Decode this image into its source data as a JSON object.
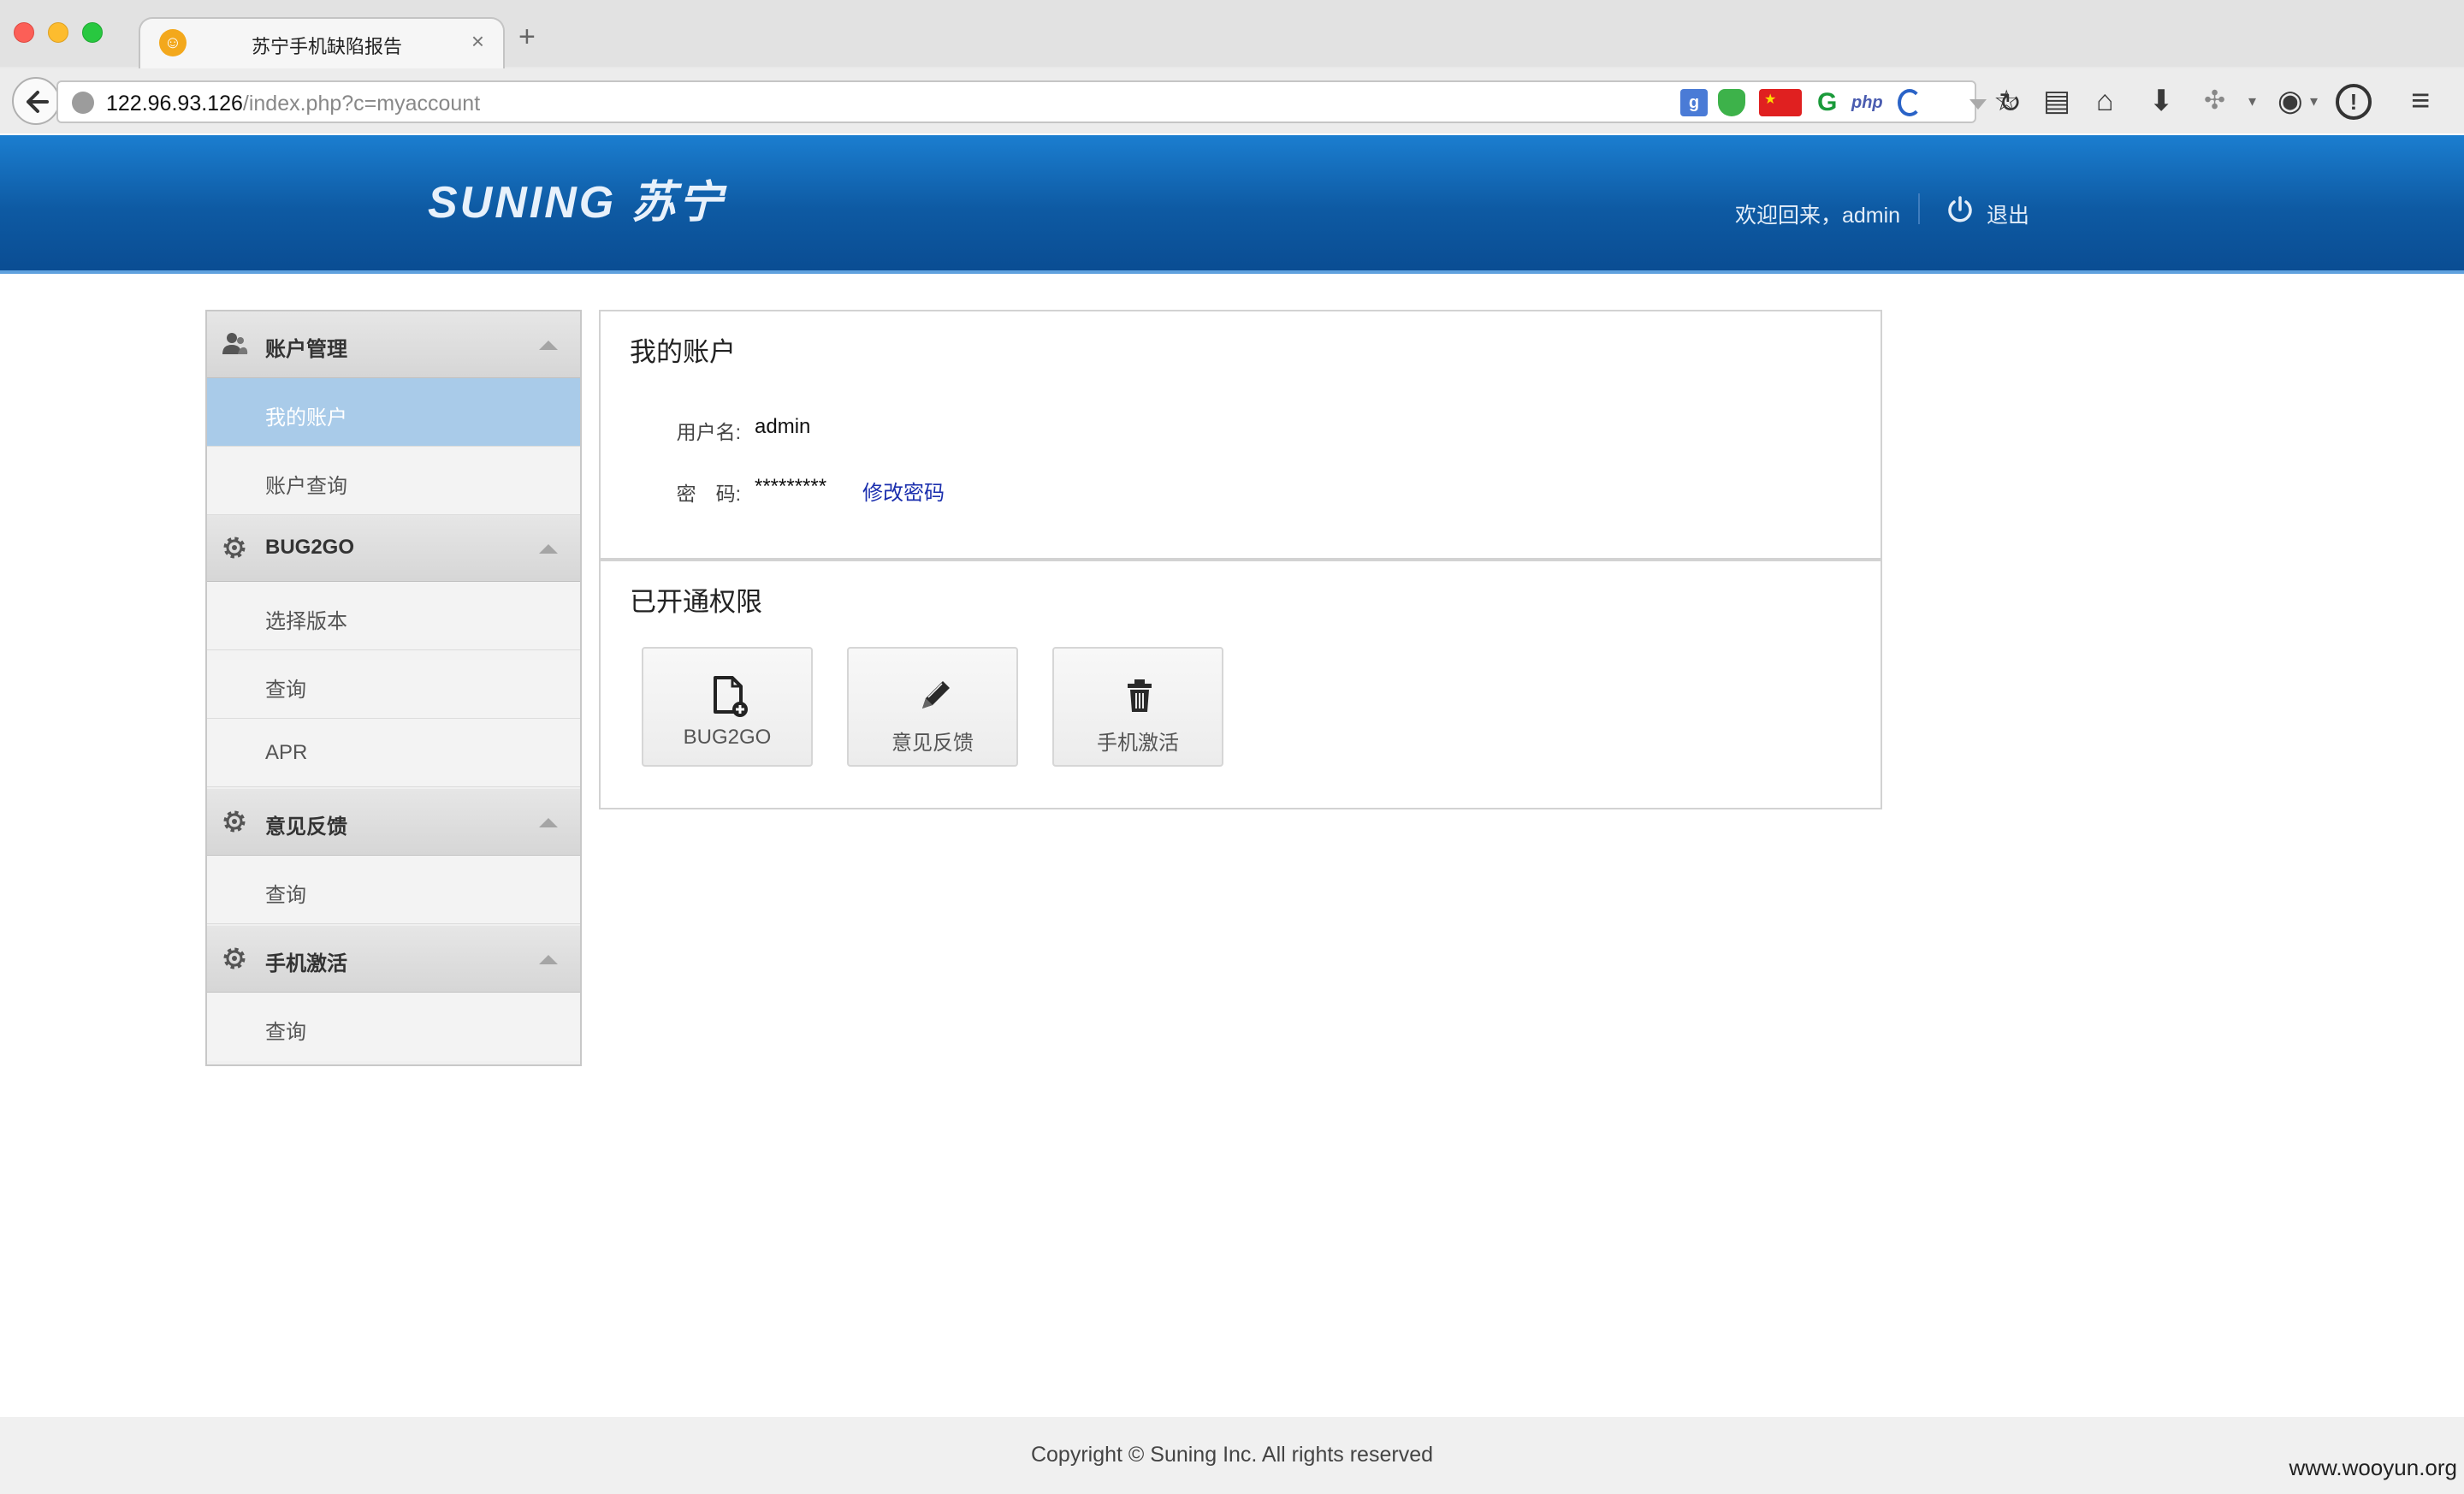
{
  "browser": {
    "tab_title": "苏宁手机缺陷报告",
    "tab_close": "×",
    "new_tab": "+",
    "url_host": "122.96.93.126",
    "url_path": "/index.php?c=myaccount",
    "ext_g": "g",
    "ext_php": "php",
    "ext_gr": "G"
  },
  "header": {
    "logo": "SUNING 苏宁",
    "welcome": "欢迎回来，admin",
    "logout": "退出",
    "brand_color": "#0e5aa3"
  },
  "sidebar": {
    "sections": [
      {
        "title": "账户管理",
        "icon": "user-group-icon",
        "items": [
          "我的账户",
          "账户查询"
        ]
      },
      {
        "title": "BUG2GO",
        "icon": "gear-icon",
        "items": [
          "选择版本",
          "查询",
          "APR"
        ]
      },
      {
        "title": "意见反馈",
        "icon": "gear-icon",
        "items": [
          "查询"
        ]
      },
      {
        "title": "手机激活",
        "icon": "gear-icon",
        "items": [
          "查询"
        ]
      }
    ],
    "active_item": "我的账户"
  },
  "account": {
    "title": "我的账户",
    "username_label": "用户名:",
    "username_value": "admin",
    "password_label": "密　码:",
    "password_value": "*********",
    "change_password_link": "修改密码"
  },
  "permissions": {
    "title": "已开通权限",
    "cards": [
      {
        "label": "BUG2GO",
        "icon": "file-add-icon"
      },
      {
        "label": "意见反馈",
        "icon": "pencil-icon"
      },
      {
        "label": "手机激活",
        "icon": "trash-icon"
      }
    ]
  },
  "footer": {
    "copyright": "Copyright © Suning Inc. All rights reserved",
    "watermark": "www.wooyun.org"
  }
}
